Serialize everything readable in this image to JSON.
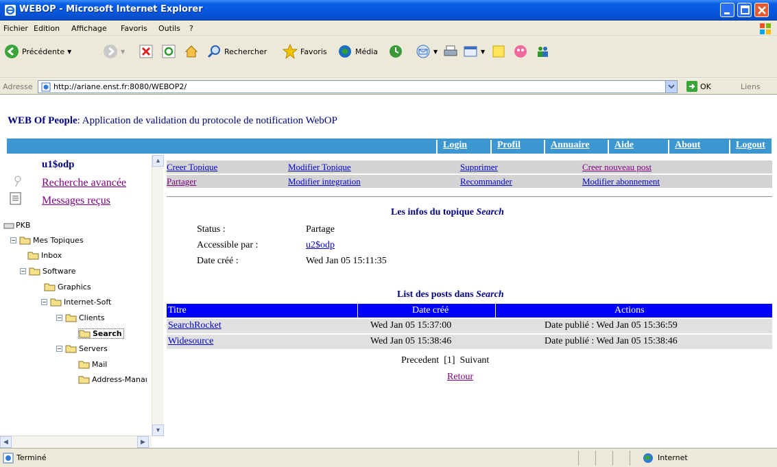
{
  "window": {
    "title": "WEBOP - Microsoft Internet Explorer"
  },
  "menubar": {
    "items": [
      "Fichier",
      "Edition",
      "Affichage",
      "Favoris",
      "Outils",
      "?"
    ]
  },
  "toolbar": {
    "back_label": "Précédente",
    "search_label": "Rechercher",
    "favorites_label": "Favoris",
    "media_label": "Média"
  },
  "addressbar": {
    "label": "Adresse",
    "url": "http://ariane.enst.fr:8080/WEBOP2/",
    "go_label": "OK",
    "links_label": "Liens"
  },
  "header": {
    "app_name": "WEB Of People",
    "app_subtitle": ": Application de validation du protocole de notification WebOP"
  },
  "nav": {
    "items": [
      "Login",
      "Profil",
      "Annuaire",
      "Aide",
      "About",
      "Logout"
    ]
  },
  "left": {
    "user": "u1$odp",
    "advanced_search": "Recherche avancée",
    "received_messages": "Messages reçus",
    "tree": {
      "root": "PKB",
      "my_topics": "Mes Topiques",
      "inbox": "Inbox",
      "software": "Software",
      "graphics": "Graphics",
      "internet_soft": "Internet-Soft",
      "clients": "Clients",
      "search": "Search",
      "servers": "Servers",
      "mail": "Mail",
      "address_manager": "Address-Manaı"
    }
  },
  "actions": {
    "row1": [
      "Creer Topique",
      "Modifier Topique",
      "Supprimer",
      "Creer nouveau post"
    ],
    "row2": [
      "Partager",
      "Modifier integration",
      "Recommander",
      "Modifier abonnement"
    ]
  },
  "topic_info": {
    "title_prefix": "Les infos du topique",
    "topic_name": "Search",
    "status_label": "Status :",
    "status_value": "Partage",
    "access_label": "Accessible par :",
    "access_value": "u2$odp",
    "created_label": "Date créé :",
    "created_value": "Wed Jan 05 15:11:35"
  },
  "posts": {
    "title_prefix": "List des posts dans",
    "topic_name": "Search",
    "headers": [
      "Titre",
      "Date créé",
      "Actions"
    ],
    "rows": [
      {
        "title": "SearchRocket",
        "date": "Wed Jan 05 15:37:00",
        "action": "Date publié : Wed Jan 05 15:36:59"
      },
      {
        "title": "Widesource",
        "date": "Wed Jan 05 15:38:46",
        "action": "Date publié : Wed Jan 05 15:38:46"
      }
    ],
    "pager_prev": "Precedent",
    "pager_current": "[1]",
    "pager_next": "Suivant",
    "back_link": "Retour"
  },
  "status": {
    "text": "Terminé",
    "zone": "Internet"
  },
  "colors": {
    "navbar": "#3c96d0",
    "table_header": "#0000ff",
    "title_color": "#000080",
    "visited_link": "#800080"
  }
}
